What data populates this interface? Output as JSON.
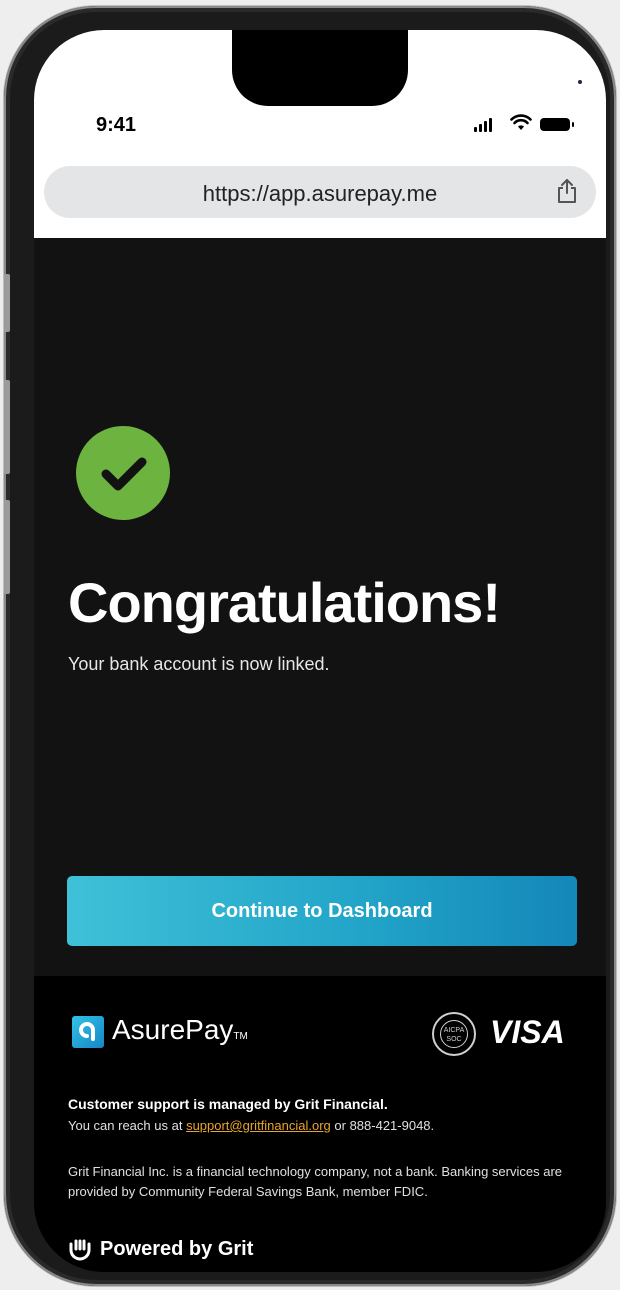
{
  "status_bar": {
    "time": "9:41"
  },
  "browser": {
    "url": "https://app.asurepay.me"
  },
  "main": {
    "headline": "Congratulations!",
    "message": "Your bank account is now linked.",
    "cta_label": "Continue to Dashboard"
  },
  "footer": {
    "brand_name": "AsurePay",
    "brand_tm": "TM",
    "seal_text": "AICPA SOC",
    "card_network": "VISA",
    "support_title": "Customer support is managed by Grit Financial.",
    "support_prefix": "You can reach us at",
    "support_email": "support@gritfinancial.org",
    "support_suffix": "or 888-421-9048.",
    "disclaimer": "Grit Financial Inc. is a financial technology company, not a bank. Banking services are provided by Community Federal Savings Bank, member FDIC.",
    "powered_by": "Powered by Grit"
  },
  "colors": {
    "success": "#6cb33f",
    "cta_start": "#3fc1d8",
    "cta_end": "#1487b9",
    "link": "#e8a42a"
  },
  "icons": [
    "signal-icon",
    "wifi-icon",
    "battery-icon",
    "share-icon",
    "checkmark-icon",
    "asurepay-logo-icon",
    "grit-logo-icon"
  ]
}
